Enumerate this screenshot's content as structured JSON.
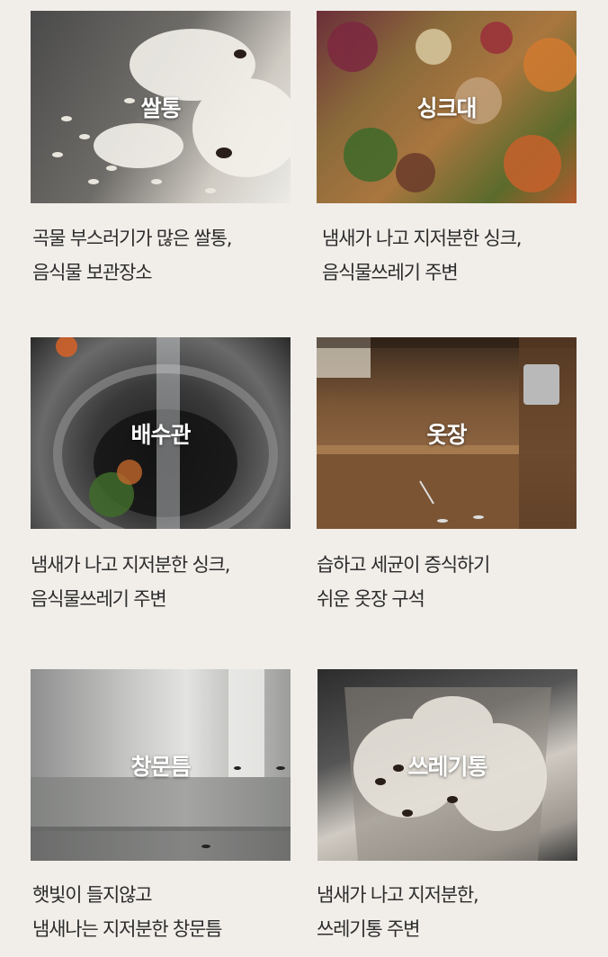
{
  "cards": [
    {
      "label": "쌀통",
      "icon": "rice-bin-photo",
      "desc": [
        "곡물 부스러기가 많은 쌀통,",
        "음식물 보관장소"
      ]
    },
    {
      "label": "싱크대",
      "icon": "sink-food-waste-photo",
      "desc": [
        "냄새가 나고 지저분한 싱크,",
        "음식물쓰레기 주변"
      ]
    },
    {
      "label": "배수관",
      "icon": "drain-pipe-photo",
      "desc": [
        "냄새가 나고 지저분한 싱크,",
        "음식물쓰레기 주변"
      ]
    },
    {
      "label": "옷장",
      "icon": "wardrobe-photo",
      "desc": [
        "습하고 세균이 증식하기",
        "쉬운 옷장 구석"
      ]
    },
    {
      "label": "창문틈",
      "icon": "window-gap-photo",
      "desc": [
        "햇빛이 들지않고",
        "냄새나는 지저분한 창문틈"
      ]
    },
    {
      "label": "쓰레기통",
      "icon": "trash-can-photo",
      "desc": [
        "냄새가 나고 지저분한,",
        "쓰레기통 주변"
      ]
    }
  ],
  "colors": {
    "background": "#f1eeea",
    "text": "#2c2c2c",
    "label": "#ffffff"
  }
}
